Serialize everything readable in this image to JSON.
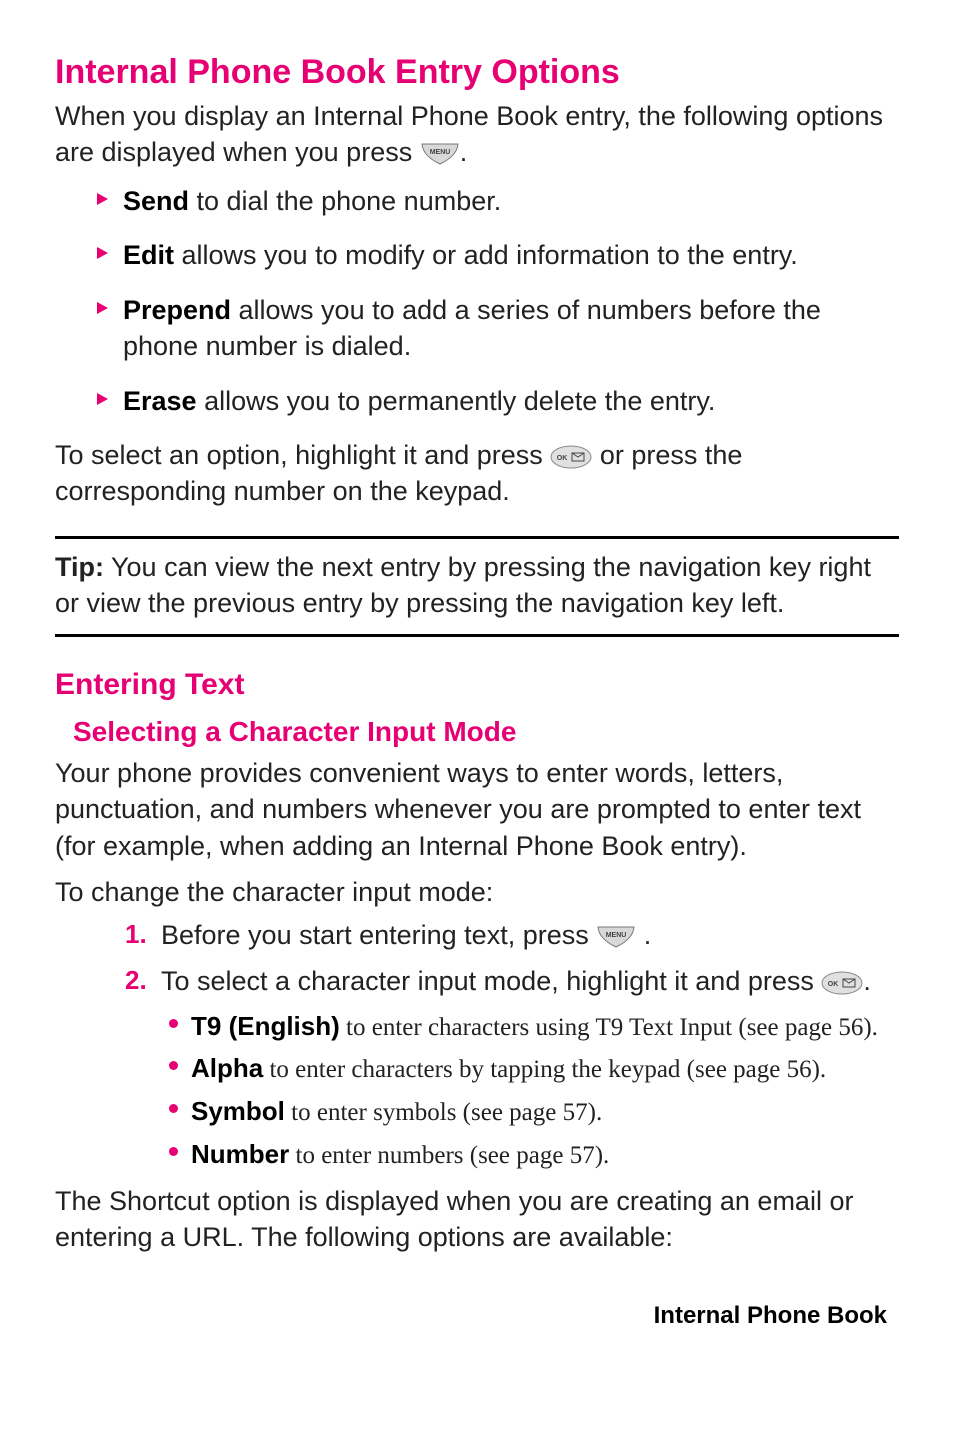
{
  "section1": {
    "title": "Internal Phone Book Entry Options",
    "intro_a": "When you display an Internal Phone Book entry, the following options are displayed when you press ",
    "intro_b": ".",
    "options": [
      {
        "label": "Send",
        "desc": " to dial the phone number."
      },
      {
        "label": "Edit",
        "desc": " allows you to modify or add information to the entry."
      },
      {
        "label": "Prepend",
        "desc": " allows you to add a series of numbers before the phone number is dialed."
      },
      {
        "label": "Erase",
        "desc": " allows you to permanently delete the entry."
      }
    ],
    "select_a": "To select an option, highlight it and press ",
    "select_b": " or press the corresponding number on the keypad."
  },
  "tip": {
    "label": "Tip:",
    "text": " You can view the next entry by pressing the navigation key right or view the previous entry by pressing the navigation key left."
  },
  "section2": {
    "title": "Entering Text",
    "subtitle": "Selecting a Character Input Mode",
    "intro": "Your phone provides convenient ways to enter words, letters, punctuation, and numbers whenever you are prompted to enter text (for example, when adding an Internal Phone Book entry).",
    "lead": "To change the character input mode:",
    "step1_a": "Before you start entering text, press ",
    "step1_b": " .",
    "step2_a": "To select a character input mode, highlight it and press ",
    "step2_b": ".",
    "modes": [
      {
        "label": "T9 (English)",
        "desc": " to enter characters using T9 Text Input (see page 56)."
      },
      {
        "label": "Alpha",
        "desc": " to enter characters by tapping the keypad (see page 56)."
      },
      {
        "label": "Symbol",
        "desc": " to enter symbols (see page 57)."
      },
      {
        "label": "Number",
        "desc": " to enter numbers (see page 57)."
      }
    ],
    "shortcut": "The Shortcut option is displayed when you are creating an email or entering a URL. The following options are available:"
  },
  "footer": "Internal Phone Book"
}
